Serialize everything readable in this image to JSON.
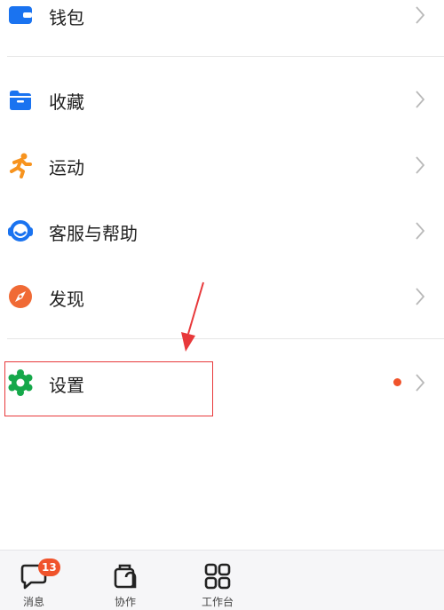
{
  "menu": {
    "items": [
      {
        "label": "钱包",
        "icon": "wallet-icon"
      },
      {
        "label": "收藏",
        "icon": "folder-icon"
      },
      {
        "label": "运动",
        "icon": "running-icon"
      },
      {
        "label": "客服与帮助",
        "icon": "customer-service-icon"
      },
      {
        "label": "发现",
        "icon": "compass-icon"
      },
      {
        "label": "设置",
        "icon": "settings-gear-icon",
        "has_notification_dot": true
      }
    ]
  },
  "tabbar": {
    "tabs": [
      {
        "label": "消息",
        "icon": "message-bubble-icon",
        "badge": "13"
      },
      {
        "label": "协作",
        "icon": "collaboration-icon"
      },
      {
        "label": "工作台",
        "icon": "workbench-grid-icon"
      }
    ]
  },
  "colors": {
    "wallet": "#1a73f0",
    "folder": "#1a73f0",
    "running": "#f7931e",
    "service": "#1a73f0",
    "compass": "#f06a35",
    "gear": "#15a84a",
    "notification_dot": "#f0532b",
    "badge": "#f0532b",
    "annotation": "#e8393b"
  }
}
